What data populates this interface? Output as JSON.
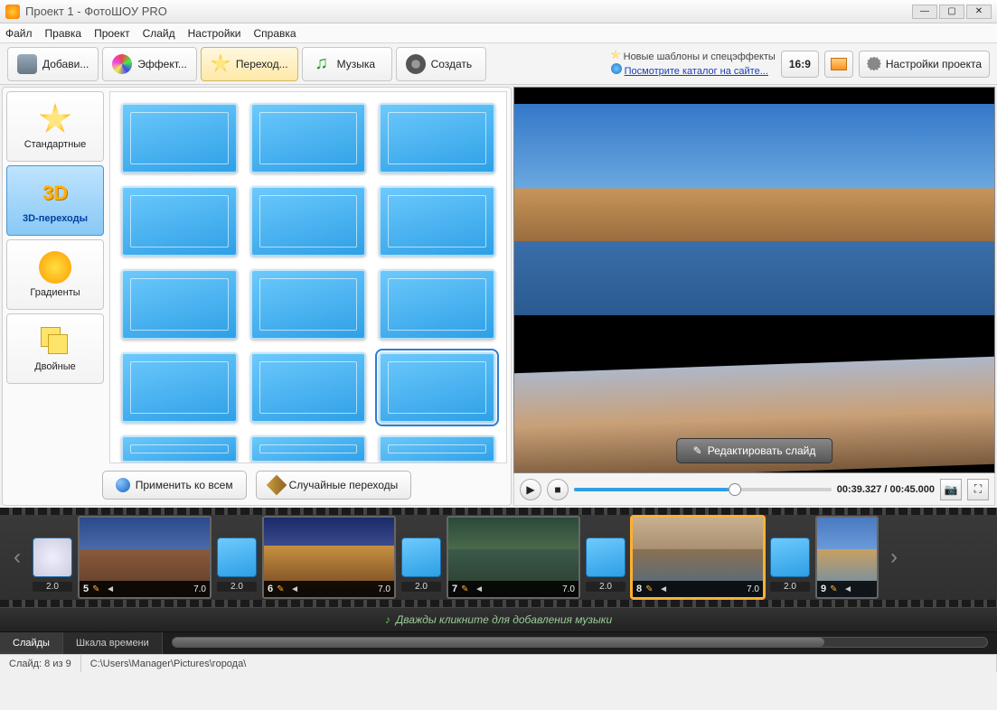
{
  "window": {
    "title": "Проект 1 - ФотоШОУ PRO"
  },
  "menu": {
    "file": "Файл",
    "edit": "Правка",
    "project": "Проект",
    "slide": "Слайд",
    "settings": "Настройки",
    "help": "Справка"
  },
  "tabs": {
    "add": "Добави...",
    "effects": "Эффект...",
    "transitions": "Переход...",
    "music": "Музыка",
    "create": "Создать"
  },
  "notif": {
    "line1": "Новые шаблоны и спецэффекты",
    "link": "Посмотрите каталог на сайте..."
  },
  "buttons": {
    "aspect": "16:9",
    "project_settings": "Настройки проекта",
    "apply_all": "Применить ко всем",
    "random": "Случайные переходы",
    "edit_slide": "Редактировать слайд"
  },
  "categories": {
    "standard": "Стандартные",
    "three_d": "3D-переходы",
    "gradients": "Градиенты",
    "double": "Двойные",
    "three_d_label": "3D"
  },
  "playback": {
    "time": "00:39.327 / 00:45.000"
  },
  "timeline": {
    "nav_trans_duration": "2.0",
    "slides": [
      {
        "num": "5",
        "dur": "7.0",
        "trans_dur": "2.0"
      },
      {
        "num": "6",
        "dur": "7.0",
        "trans_dur": "2.0"
      },
      {
        "num": "7",
        "dur": "7.0",
        "trans_dur": "2.0"
      },
      {
        "num": "8",
        "dur": "7.0",
        "trans_dur": "2.0",
        "selected": true
      },
      {
        "num": "9",
        "dur": "",
        "trans_dur": "2.0"
      }
    ],
    "music_hint": "Дважды кликните для добавления музыки",
    "view_slides": "Слайды",
    "view_timeline": "Шкала времени"
  },
  "status": {
    "slide": "Слайд: 8 из 9",
    "path": "C:\\Users\\Manager\\Pictures\\города\\"
  }
}
